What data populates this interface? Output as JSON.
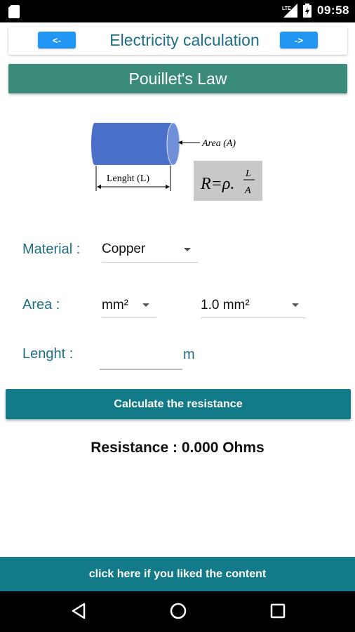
{
  "status_bar": {
    "time": "09:58",
    "network": "LTE",
    "icons": [
      "sd-card-icon",
      "lte-signal-icon",
      "battery-icon"
    ]
  },
  "header": {
    "prev_label": "<-",
    "title": "Electricity calculation",
    "next_label": "->"
  },
  "law_title": "Pouillet's Law",
  "diagram": {
    "area_label": "Area (A)",
    "length_label": "Lenght (L)",
    "formula_left": "R=ρ.",
    "formula_num": "L",
    "formula_den": "A",
    "colors": {
      "cylinder": "#4a6fc8",
      "formula_bg": "#c8c8c8"
    }
  },
  "form": {
    "material_label": "Material :",
    "material_value": "Copper",
    "area_label": "Area :",
    "area_unit_value": "mm²",
    "area_size_value": "1.0 mm²",
    "length_label": "Lenght :",
    "length_value": "",
    "length_unit": "m"
  },
  "calculate_button": "Calculate the resistance",
  "result_text": "Resistance : 0.000 Ohms",
  "like_bar": "click here if you liked the content",
  "nav_bar": {
    "icons": [
      "back-icon",
      "home-icon",
      "recents-icon"
    ]
  },
  "colors": {
    "accent_blue": "#2196f3",
    "teal": "#127a88",
    "green_bar": "#3a8b7a",
    "label_teal": "#1f6f84"
  }
}
